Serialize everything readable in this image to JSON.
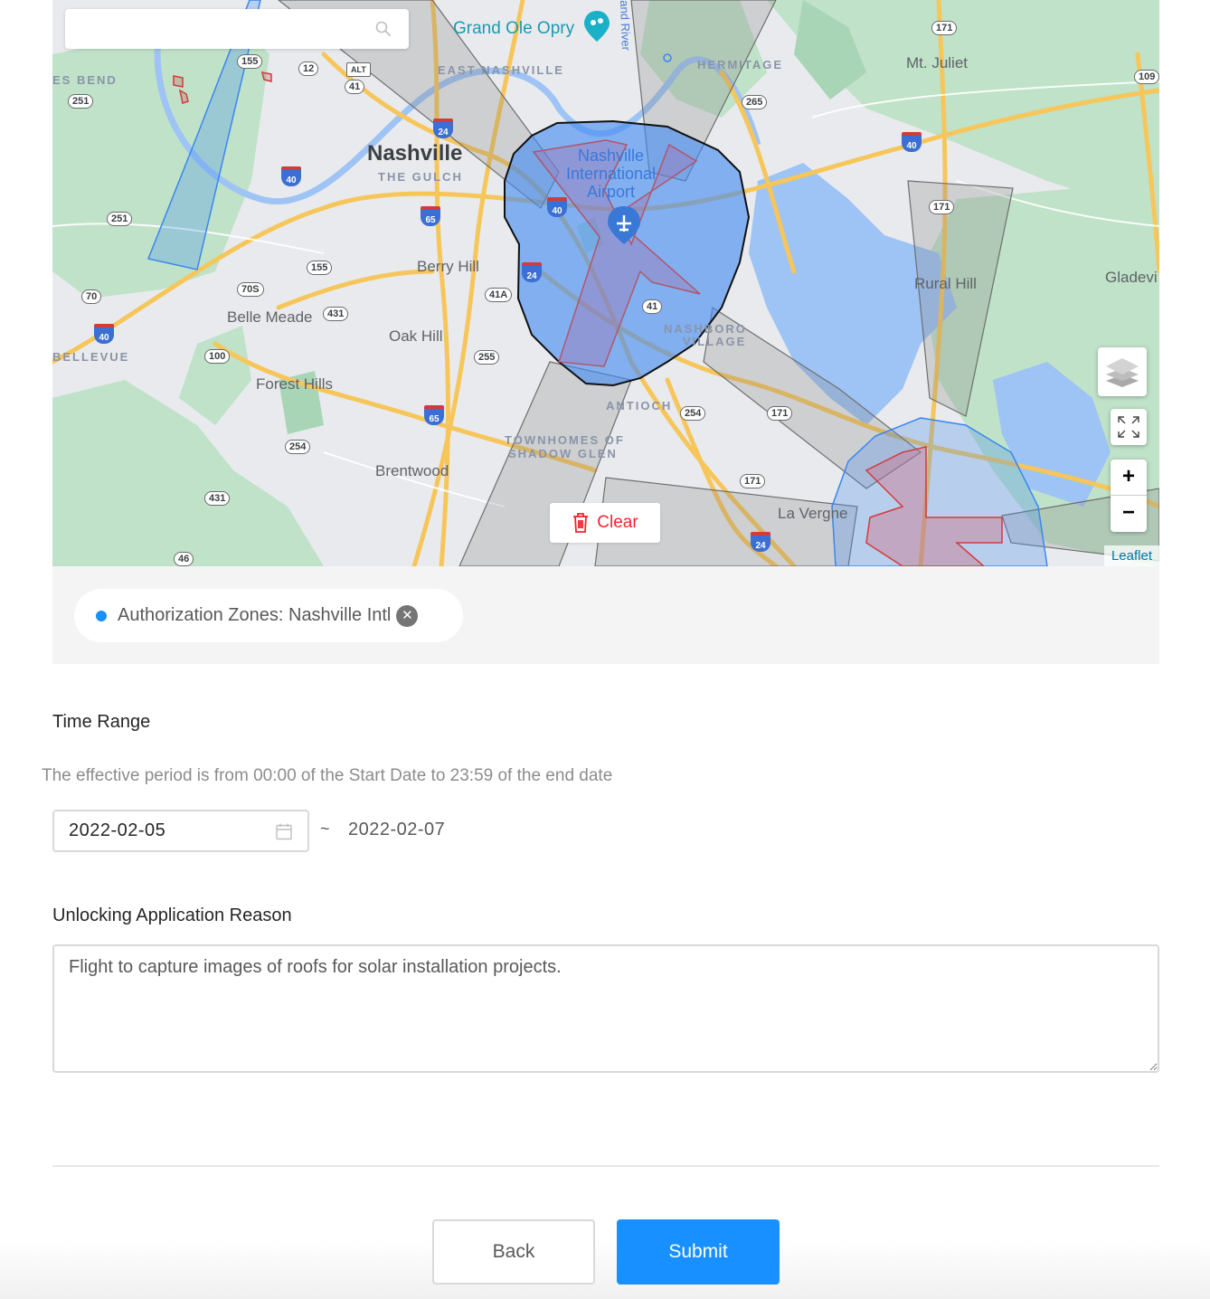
{
  "map": {
    "search": {
      "placeholder": "",
      "value": ""
    },
    "labels": {
      "nashville": "Nashville",
      "the_gulch": "THE GULCH",
      "east_nashville": "EAST NASHVILLE",
      "grand_ole_opry": "Grand Ole Opry",
      "hermitage": "HERMITAGE",
      "mt_juliet": "Mt. Juliet",
      "airport_line1": "Nashville",
      "airport_line2": "International",
      "airport_line3": "Airport",
      "berry_hill": "Berry Hill",
      "belle_meade": "Belle Meade",
      "oak_hill": "Oak Hill",
      "forest_hills": "Forest Hills",
      "bellevue": "BELLEVUE",
      "brentwood": "Brentwood",
      "antioch": "ANTIOCH",
      "nashboro_village_1": "NASHBORO",
      "nashboro_village_2": "VILLAGE",
      "townhomes_1": "TOWNHOMES OF",
      "townhomes_2": "SHADOW GLEN",
      "rural_hill": "Rural Hill",
      "gladeville": "Gladevi",
      "la_vergne": "La Vergne",
      "bells_bend": "ES BEND",
      "cumberland_river": "and River"
    },
    "route_shields": [
      "171",
      "12",
      "41",
      "ALT",
      "251",
      "251",
      "155",
      "70S",
      "431",
      "70",
      "100",
      "255",
      "254",
      "431",
      "46",
      "265",
      "171",
      "171",
      "254",
      "171",
      "41A",
      "41",
      "109",
      "155"
    ],
    "interstate_shields": [
      "24",
      "40",
      "40",
      "65",
      "24",
      "40",
      "65",
      "24",
      "40"
    ],
    "controls": {
      "layers_icon": "layers-icon",
      "fullscreen_icon": "fullscreen-icon",
      "zoom_in": "+",
      "zoom_out": "−"
    },
    "attribution": "Leaflet",
    "clear_button": "Clear"
  },
  "selected_zones": [
    {
      "label": "Authorization Zones: Nashville Intl",
      "color": "#1890ff"
    }
  ],
  "time_range": {
    "label": "Time Range",
    "hint": "The effective period is from 00:00 of the Start Date to 23:59 of the end date",
    "start_date": "2022-02-05",
    "separator": "~",
    "end_date": "2022-02-07"
  },
  "reason": {
    "label": "Unlocking Application Reason",
    "value": "Flight to capture images of roofs for solar installation projects."
  },
  "actions": {
    "back": "Back",
    "submit": "Submit"
  },
  "colors": {
    "primary": "#1890ff",
    "danger": "#f5222d",
    "zone_fill": "#4a90f0",
    "restricted_outline": "#d23b3b"
  }
}
